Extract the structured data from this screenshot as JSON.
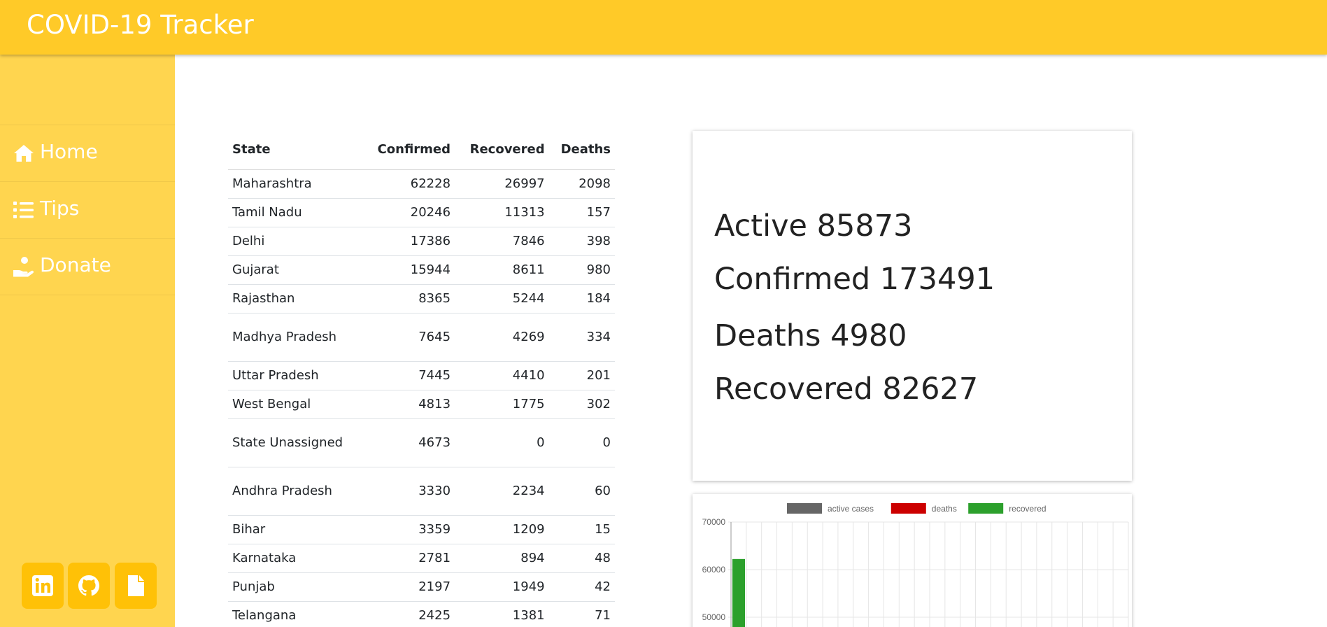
{
  "header": {
    "title": "COVID-19 Tracker"
  },
  "sidebar": {
    "items": [
      {
        "label": "Home",
        "icon": "home-icon"
      },
      {
        "label": "Tips",
        "icon": "list-icon"
      },
      {
        "label": "Donate",
        "icon": "donate-hand-icon"
      }
    ],
    "social": [
      {
        "icon": "linkedin-icon"
      },
      {
        "icon": "github-icon"
      },
      {
        "icon": "document-icon"
      }
    ]
  },
  "table": {
    "headers": [
      "State",
      "Confirmed",
      "Recovered",
      "Deaths"
    ],
    "rows": [
      [
        "Maharashtra",
        "62228",
        "26997",
        "2098"
      ],
      [
        "Tamil Nadu",
        "20246",
        "11313",
        "157"
      ],
      [
        "Delhi",
        "17386",
        "7846",
        "398"
      ],
      [
        "Gujarat",
        "15944",
        "8611",
        "980"
      ],
      [
        "Rajasthan",
        "8365",
        "5244",
        "184"
      ],
      [
        "Madhya Pradesh",
        "7645",
        "4269",
        "334"
      ],
      [
        "Uttar Pradesh",
        "7445",
        "4410",
        "201"
      ],
      [
        "West Bengal",
        "4813",
        "1775",
        "302"
      ],
      [
        "State Unassigned",
        "4673",
        "0",
        "0"
      ],
      [
        "Andhra Pradesh",
        "3330",
        "2234",
        "60"
      ],
      [
        "Bihar",
        "3359",
        "1209",
        "15"
      ],
      [
        "Karnataka",
        "2781",
        "894",
        "48"
      ],
      [
        "Punjab",
        "2197",
        "1949",
        "42"
      ],
      [
        "Telangana",
        "2425",
        "1381",
        "71"
      ]
    ]
  },
  "summary": {
    "active": "Active 85873",
    "confirmed": "Confirmed 173491",
    "deaths": "Deaths 4980",
    "recovered": "Recovered 82627"
  },
  "chart_data": {
    "type": "bar",
    "series": [
      {
        "name": "active cases",
        "color": "#666666"
      },
      {
        "name": "deaths",
        "color": "#cc0000"
      },
      {
        "name": "recovered",
        "color": "#2ca02c",
        "values": [
          62228
        ]
      }
    ],
    "yticks": [
      "70000",
      "60000",
      "50000"
    ],
    "ylim": [
      50000,
      70000
    ],
    "grid": true,
    "legend": "top"
  },
  "colors": {
    "header": "#ffca28",
    "sidebar": "#ffd54f",
    "social_button": "#ffc107"
  }
}
